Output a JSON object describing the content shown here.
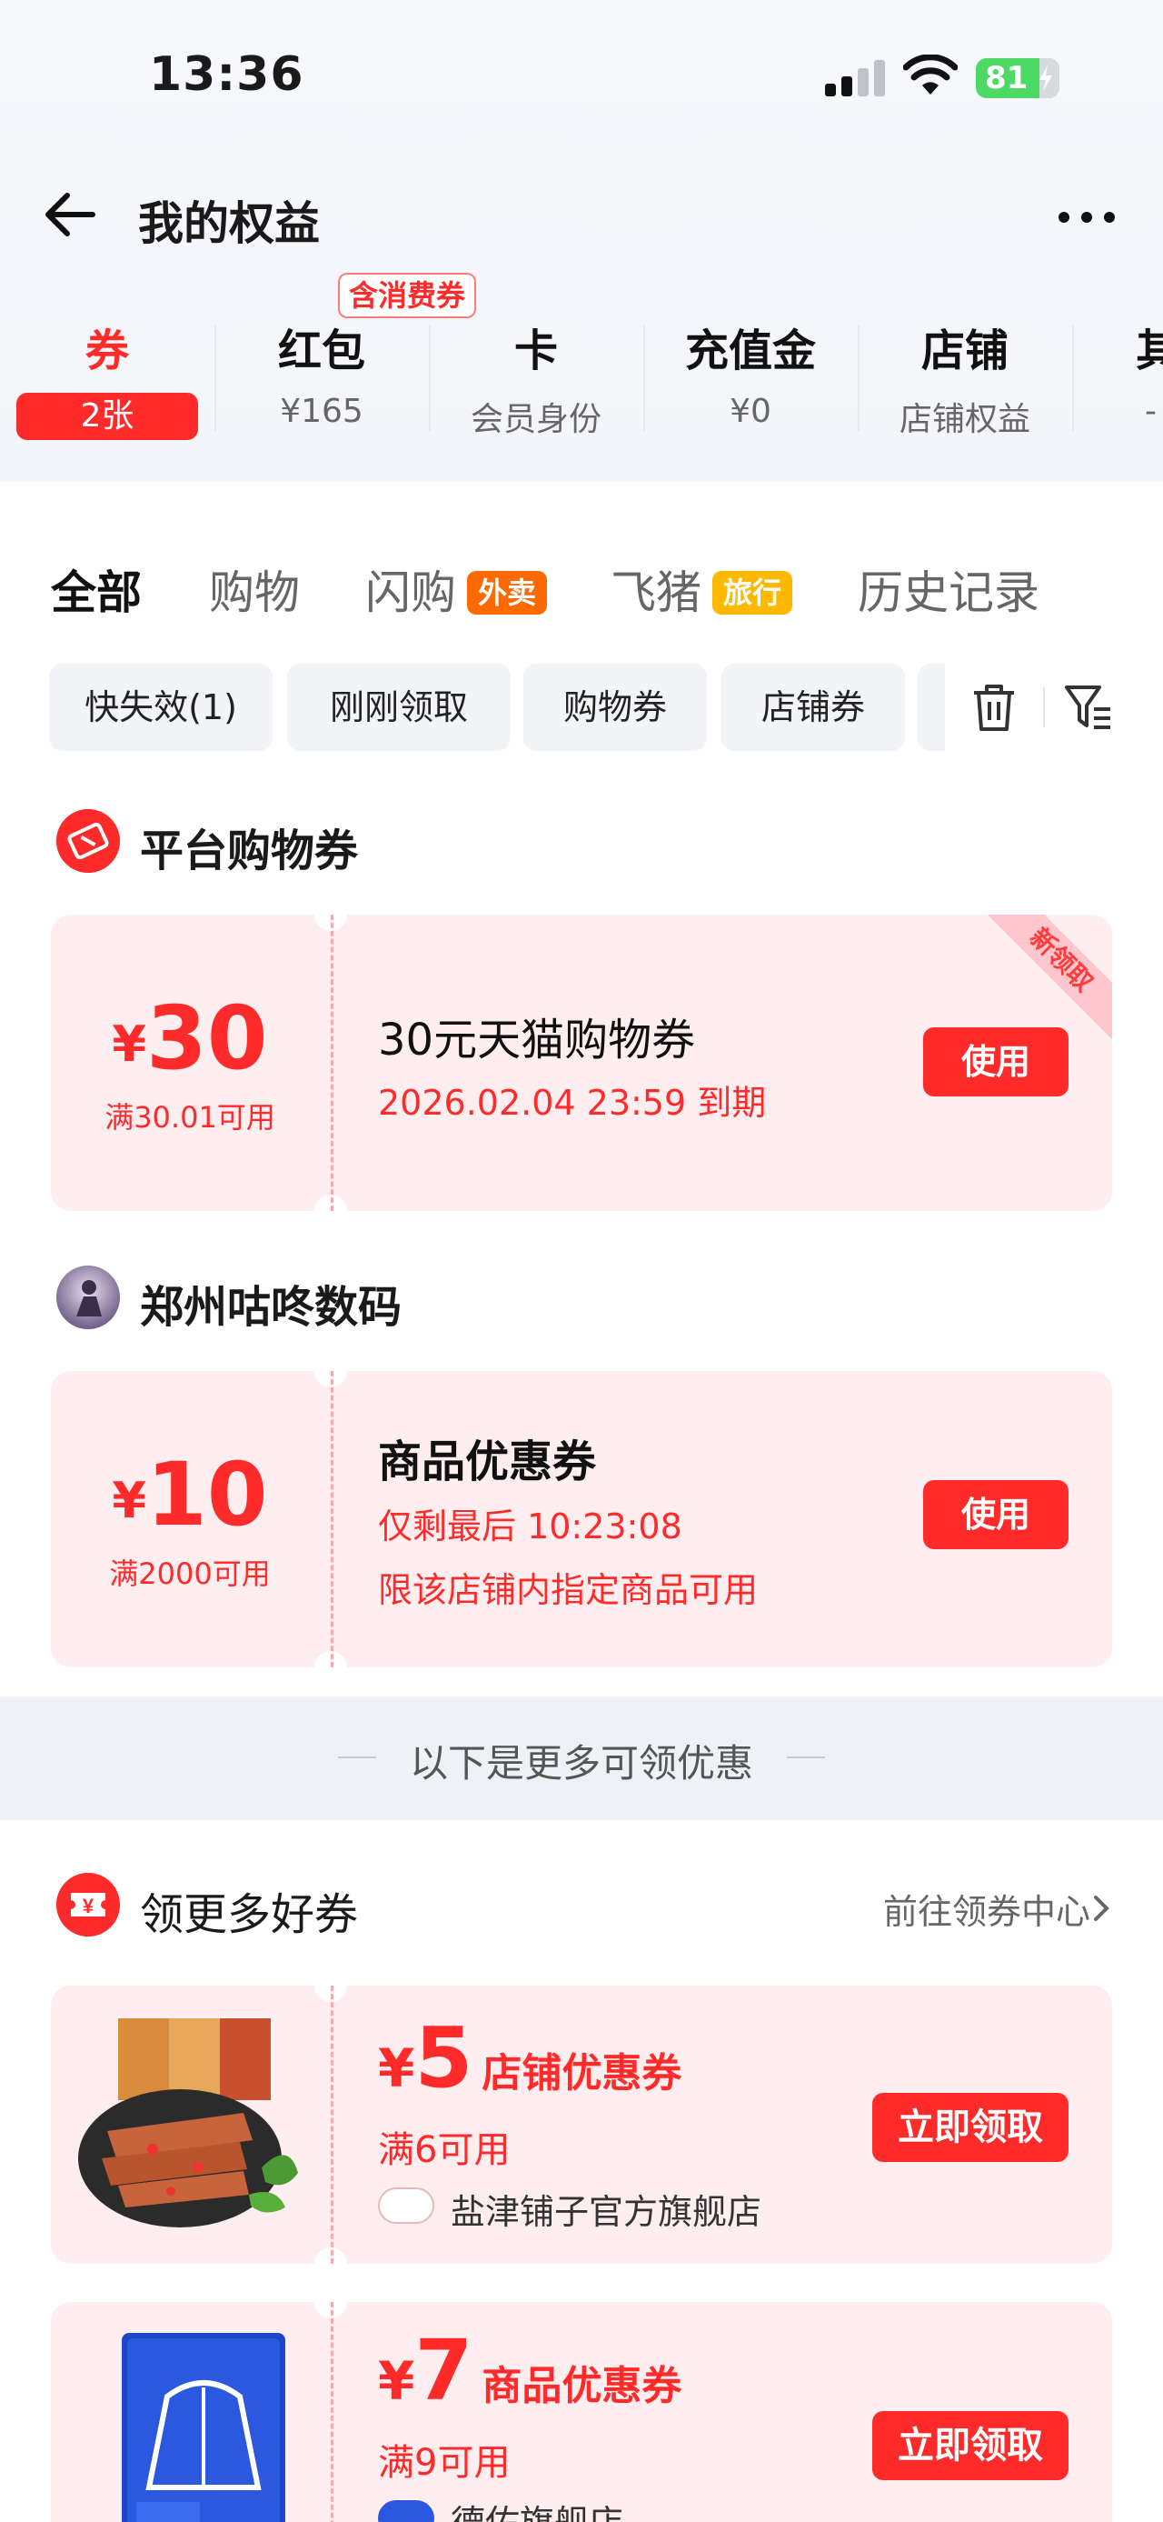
{
  "status_bar": {
    "time": "13:36",
    "battery": "81"
  },
  "nav": {
    "title": "我的权益"
  },
  "benefit_tabs": {
    "consume_tag": "含消费券",
    "items": [
      {
        "title": "券",
        "sub": "2张"
      },
      {
        "title": "红包",
        "sub": "¥165"
      },
      {
        "title": "卡",
        "sub": "会员身份"
      },
      {
        "title": "充值金",
        "sub": "¥0"
      },
      {
        "title": "店铺",
        "sub": "店铺权益"
      },
      {
        "title": "其",
        "sub": "-"
      }
    ]
  },
  "filter_tabs": {
    "items": [
      {
        "label": "全部"
      },
      {
        "label": "购物"
      },
      {
        "label": "闪购",
        "badge": "外卖"
      },
      {
        "label": "飞猪",
        "badge": "旅行"
      },
      {
        "label": "历史记录"
      }
    ],
    "badge_colors": {
      "waimai": "#ff6a00",
      "lvxing": "#ffb800"
    }
  },
  "chips": [
    "快失效(1)",
    "刚刚领取",
    "购物券",
    "店铺券"
  ],
  "platform_section": {
    "title": "平台购物券",
    "coupon": {
      "yen": "¥",
      "amount": "30",
      "condition": "满30.01可用",
      "title": "30元天猫购物券",
      "expiry": "2026.02.04 23:59 到期",
      "button": "使用",
      "ribbon": "新领取"
    }
  },
  "store_section": {
    "title": "郑州咕咚数码",
    "coupon": {
      "yen": "¥",
      "amount": "10",
      "condition": "满2000可用",
      "title": "商品优惠券",
      "countdown": "仅剩最后 10:23:08",
      "limit": "限该店铺内指定商品可用",
      "button": "使用"
    }
  },
  "more_band": {
    "text": "以下是更多可领优惠"
  },
  "more_section": {
    "title": "领更多好券",
    "link": "前往领券中心",
    "coupons": [
      {
        "yen": "¥",
        "amount": "5",
        "label": "店铺优惠券",
        "condition": "满6可用",
        "shop": "盐津铺子官方旗舰店",
        "button": "立即领取"
      },
      {
        "yen": "¥",
        "amount": "7",
        "label": "商品优惠券",
        "condition": "满9可用",
        "shop": "德佑旗舰店",
        "button": "立即领取"
      }
    ]
  },
  "colors": {
    "accent": "#ff2a2a",
    "coupon_bg": "#ffeef0"
  }
}
